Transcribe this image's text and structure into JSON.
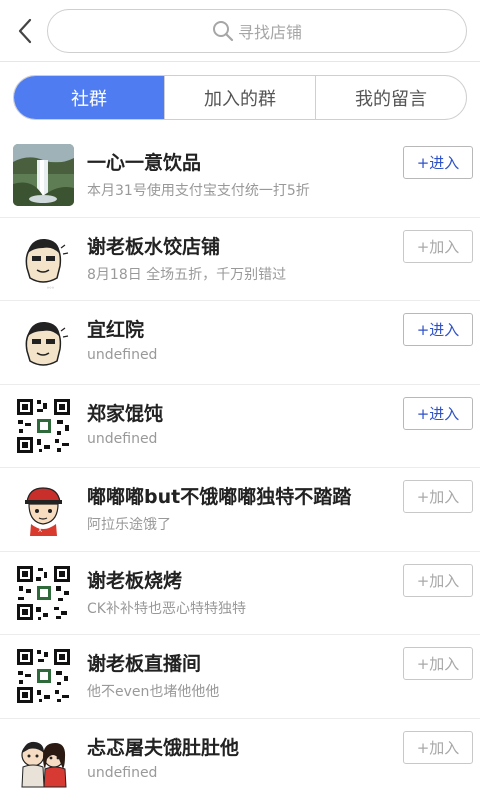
{
  "header": {
    "back_icon": "chevron-left-icon",
    "search": {
      "icon": "search-icon",
      "placeholder": "寻找店铺"
    }
  },
  "tabs": [
    {
      "label": "社群",
      "active": true
    },
    {
      "label": "加入的群",
      "active": false
    },
    {
      "label": "我的留言",
      "active": false
    }
  ],
  "colors": {
    "accent": "#4f7cf0",
    "enter_text": "#2f52c8",
    "join_text": "#a8a8a8"
  },
  "groups": [
    {
      "avatar": "waterfall-photo",
      "name": "一心一意饮品",
      "desc": "本月31号使用支付宝支付统一打5折",
      "action": "+进入",
      "joined": true
    },
    {
      "avatar": "cartoon-face",
      "name": "谢老板水饺店铺",
      "desc": "8月18日 全场五折，千万别错过",
      "action": "+加入",
      "joined": false
    },
    {
      "avatar": "cartoon-face",
      "name": "宜红院",
      "desc": "undefined",
      "action": "+进入",
      "joined": true
    },
    {
      "avatar": "qr-code",
      "name": "郑家馄饨",
      "desc": "undefined",
      "action": "+进入",
      "joined": true
    },
    {
      "avatar": "cartoon-cap",
      "name": "嘟嘟嘟but不饿嘟嘟独特不踏踏",
      "desc": "阿拉乐途饿了",
      "action": "+加入",
      "joined": false
    },
    {
      "avatar": "qr-code",
      "name": "谢老板烧烤",
      "desc": "CK补补特也恶心特特独特",
      "action": "+加入",
      "joined": false
    },
    {
      "avatar": "qr-code",
      "name": "谢老板直播间",
      "desc": "他不even也堵他他他",
      "action": "+加入",
      "joined": false
    },
    {
      "avatar": "cartoon-couple",
      "name": "忐忑屠夫饿肚肚他",
      "desc": "undefined",
      "action": "+加入",
      "joined": false
    }
  ]
}
